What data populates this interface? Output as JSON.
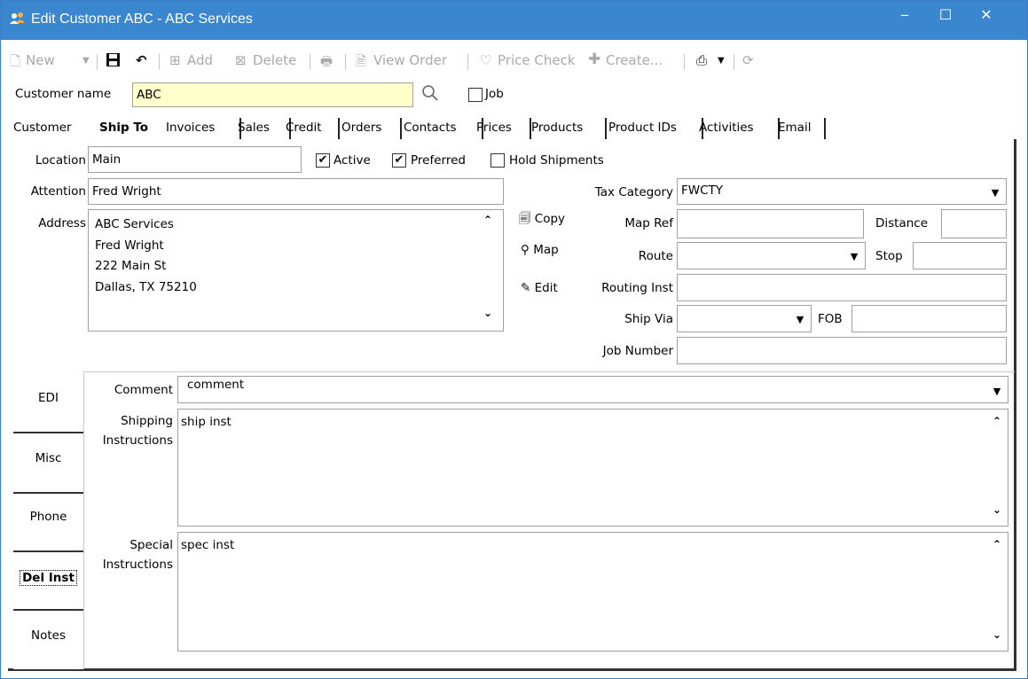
{
  "window": {
    "title": "Edit Customer ABC - ABC Services",
    "minimize": "‒",
    "maximize": "☐",
    "close": "✕"
  },
  "toolbar": {
    "new": "New",
    "add": "Add",
    "delete": "Delete",
    "view_order": "View Order",
    "price_check": "Price Check",
    "create": "Create..."
  },
  "header": {
    "customer_name_label": "Customer name",
    "customer_name_value": "ABC",
    "job_label": "Job"
  },
  "tabs": [
    "Customer",
    "Ship To",
    "Invoices",
    "Sales",
    "Credit",
    "Orders",
    "Contacts",
    "Prices",
    "Products",
    "Product IDs",
    "Activities",
    "Email"
  ],
  "ship_to": {
    "location_label": "Location",
    "location_value": "Main",
    "active_label": "Active",
    "preferred_label": "Preferred",
    "hold_label": "Hold Shipments",
    "attention_label": "Attention",
    "attention_value": "Fred Wright",
    "address_label": "Address",
    "address_lines": [
      "ABC Services",
      "Fred Wright",
      "222 Main St",
      "Dallas, TX 75210"
    ],
    "copy_label": "Copy",
    "map_label": "Map",
    "edit_label": "Edit",
    "tax_category_label": "Tax Category",
    "tax_category_value": "FWCTY",
    "map_ref_label": "Map Ref",
    "map_ref_value": "",
    "distance_label": "Distance",
    "distance_value": "",
    "route_label": "Route",
    "route_value": "",
    "stop_label": "Stop",
    "stop_value": "",
    "routing_inst_label": "Routing Inst",
    "routing_inst_value": "",
    "ship_via_label": "Ship Via",
    "ship_via_value": "",
    "fob_label": "FOB",
    "fob_value": "",
    "job_number_label": "Job Number",
    "job_number_value": ""
  },
  "side_tabs": [
    "EDI",
    "Misc",
    "Phone",
    "Del Inst",
    "Notes"
  ],
  "del_inst": {
    "comment_label": "Comment",
    "comment_value": "comment",
    "shipping_label_1": "Shipping",
    "shipping_label_2": "Instructions",
    "shipping_value": "ship inst",
    "special_label_1": "Special",
    "special_label_2": "Instructions",
    "special_value": "spec inst"
  }
}
